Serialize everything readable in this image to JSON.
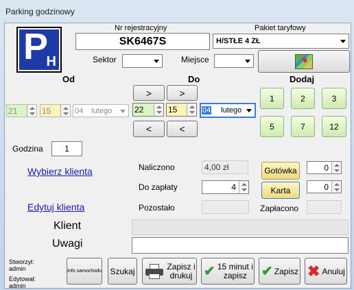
{
  "window": {
    "title": "Parking godzinowy"
  },
  "logo": {
    "letter": "P",
    "sub": "H"
  },
  "plate": {
    "label": "Nr rejestracyjny",
    "value": "SK6467S"
  },
  "tariff": {
    "label": "Pakiet taryfowy",
    "value": "H/STŁE 4 ZŁ"
  },
  "sector": {
    "label": "Sektor",
    "value": ""
  },
  "place": {
    "label": "Miejsce",
    "value": ""
  },
  "od": {
    "label": "Od",
    "hour": "21",
    "minute": "15",
    "day": "04",
    "month": "lutego"
  },
  "do": {
    "label": "Do",
    "hour": "22",
    "minute": "15",
    "day": "04",
    "month": "lutego"
  },
  "arrows": {
    "next": ">",
    "prev": "<"
  },
  "dodaj": {
    "label": "Dodaj",
    "buttons": [
      "1",
      "2",
      "3",
      "5",
      "7",
      "12"
    ]
  },
  "hours": {
    "label": "Godzina",
    "value": "1"
  },
  "links": {
    "choose": "Wybierz klienta",
    "edit": "Edytuj klienta"
  },
  "payment": {
    "charged_label": "Naliczono",
    "charged_value": "4,00 zł",
    "due_label": "Do zapłaty",
    "due_value": "4",
    "rest_label": "Pozostało",
    "paid_label": "Zapłacono",
    "cash_label": "Gotówka",
    "cash_value": "0",
    "card_label": "Karta",
    "card_value": "0"
  },
  "client": {
    "label": "Klient",
    "value": ""
  },
  "notes": {
    "label": "Uwagi",
    "value": ""
  },
  "meta": {
    "created_label": "Stworzył:",
    "created_by": "admin",
    "edited_label": "Edytował:",
    "edited_by": "admin"
  },
  "toolbar": {
    "info": "Info samochodu",
    "search": "Szukaj",
    "save_print": "Zapisz i drukuj",
    "fifteen": "15 minut i zapisz",
    "save": "Zapisz",
    "cancel": "Anuluj"
  },
  "colors": {
    "green": "#cfeab0",
    "yellow": "#efd980",
    "link": "#1a1aa6",
    "brand": "#1d3aa8"
  }
}
